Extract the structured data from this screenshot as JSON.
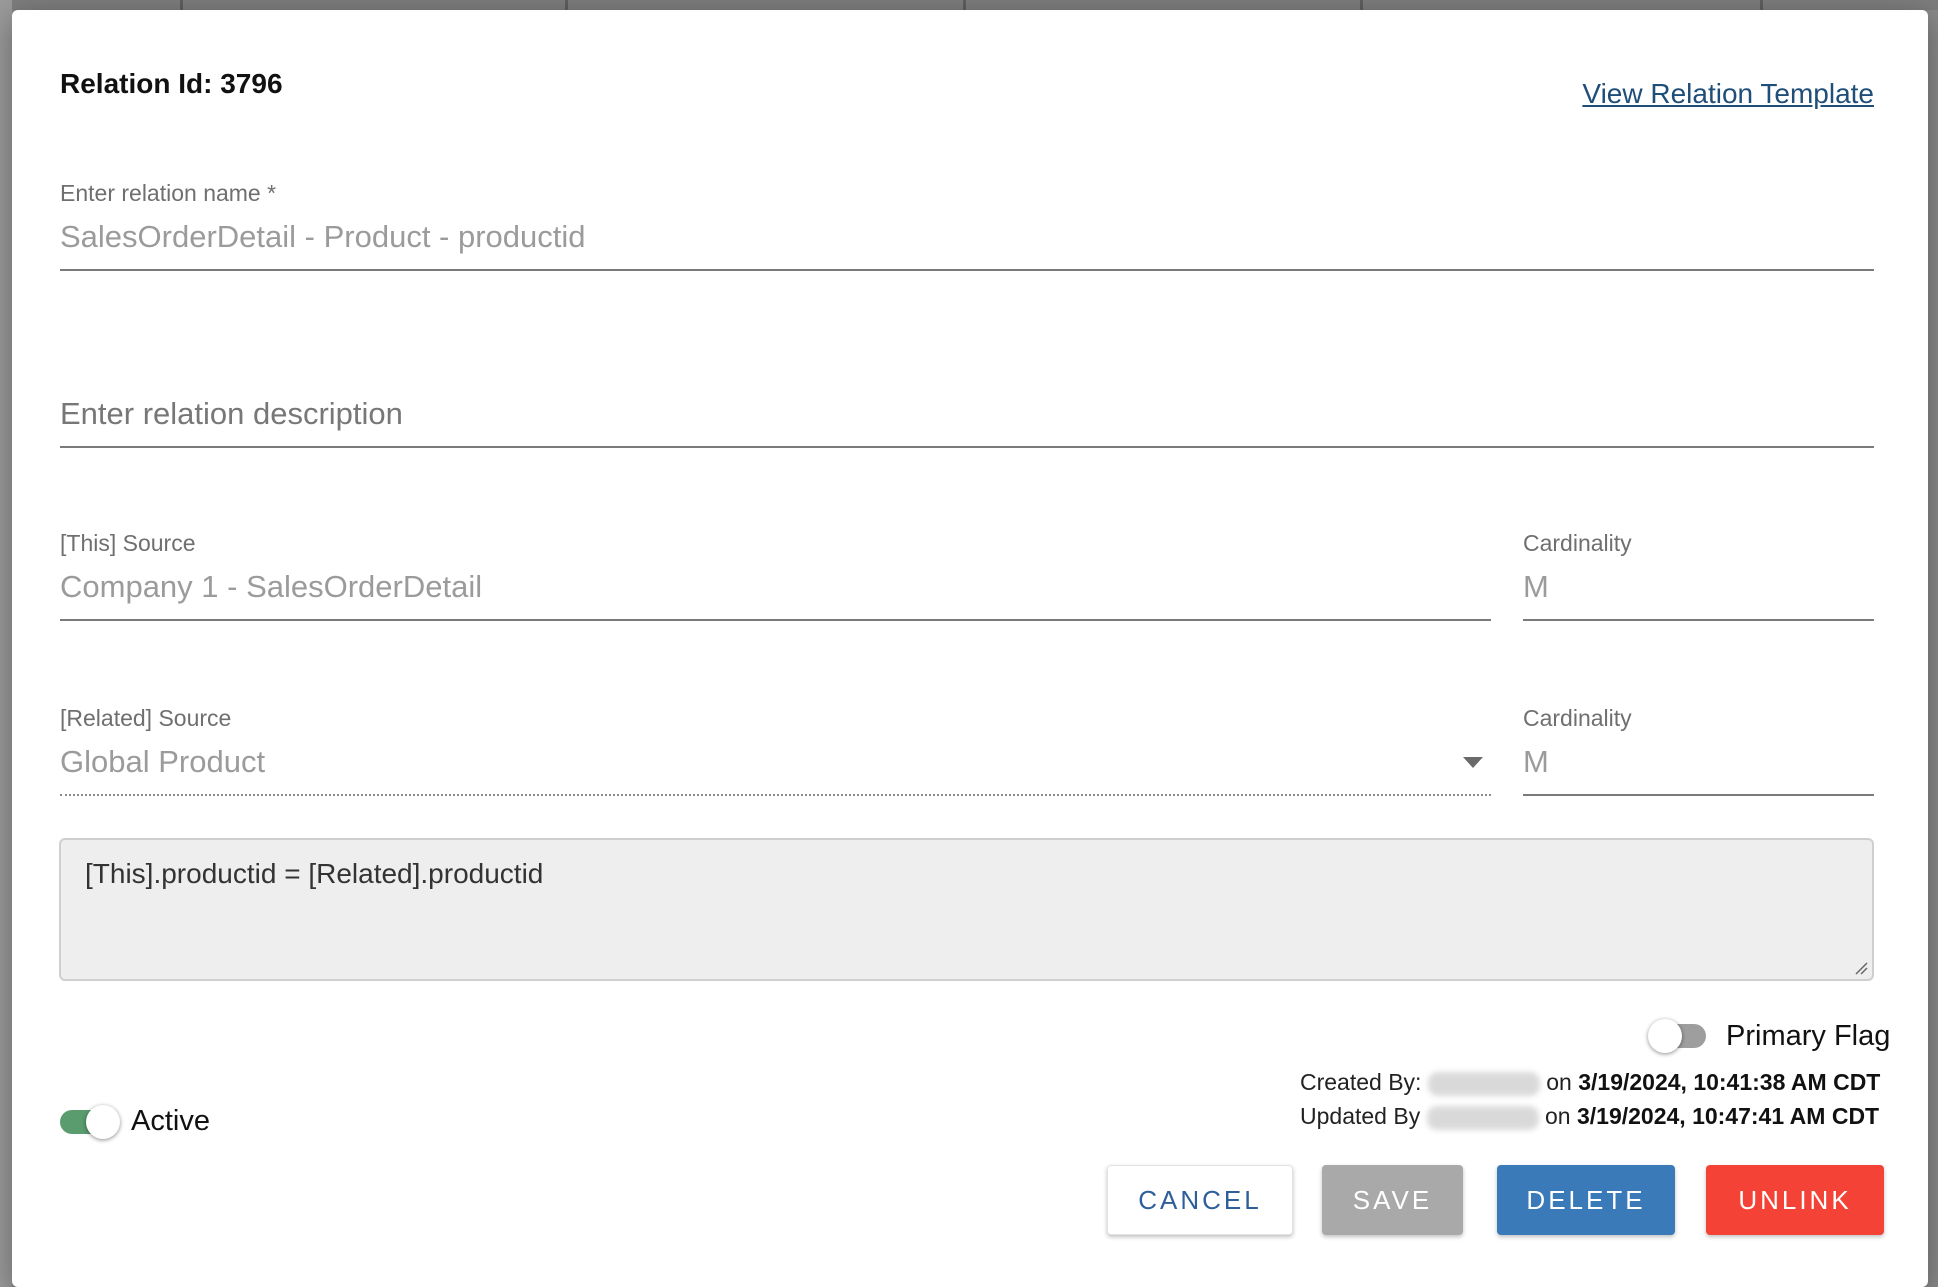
{
  "header": {
    "relation_id_label": "Relation Id: 3796",
    "view_template_link": "View Relation Template"
  },
  "relation_name": {
    "label": "Enter relation name *",
    "value": "SalesOrderDetail - Product - productid"
  },
  "relation_description": {
    "placeholder": "Enter relation description",
    "value": ""
  },
  "this_source": {
    "label": "[This] Source",
    "value": "Company 1 - SalesOrderDetail",
    "cardinality_label": "Cardinality",
    "cardinality_value": "M"
  },
  "related_source": {
    "label": "[Related] Source",
    "value": "Global Product",
    "cardinality_label": "Cardinality",
    "cardinality_value": "M"
  },
  "join_expression": "[This].productid = [Related].productid",
  "primary_flag": {
    "label": "Primary Flag",
    "on": false
  },
  "active": {
    "label": "Active",
    "on": true
  },
  "audit": {
    "created_prefix": "Created By:",
    "created_suffix": "on ",
    "created_at": "3/19/2024, 10:41:38 AM CDT",
    "updated_prefix": "Updated By",
    "updated_suffix": "on ",
    "updated_at": "3/19/2024, 10:47:41 AM CDT"
  },
  "buttons": {
    "cancel": "CANCEL",
    "save": "SAVE",
    "delete": "DELETE",
    "unlink": "UNLINK"
  },
  "colors": {
    "active_toggle": "#5a9c6e",
    "inactive_toggle": "#9e9e9e",
    "delete": "#3a7ab8",
    "unlink": "#f44336",
    "link": "#1f4e79"
  },
  "icons": [
    "dropdown-arrow-icon",
    "resize-grip-icon"
  ]
}
